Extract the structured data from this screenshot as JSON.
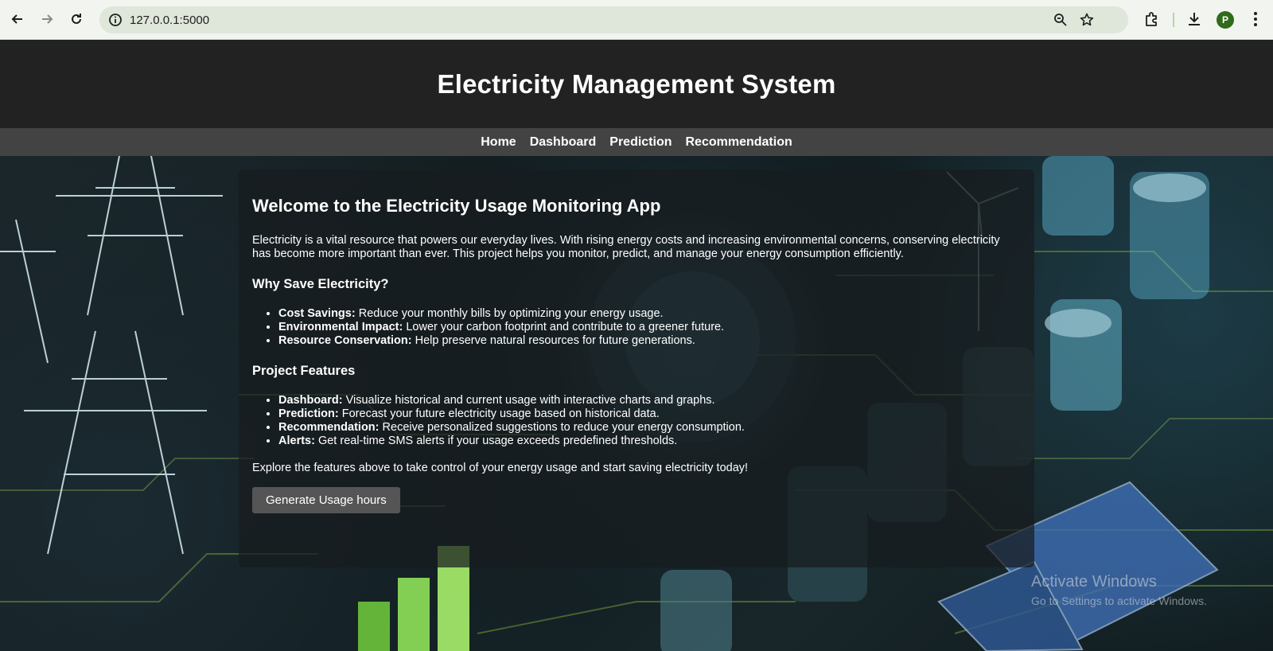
{
  "browser": {
    "url": "127.0.0.1:5000",
    "avatar_letter": "P",
    "icons": [
      "back-arrow-icon",
      "forward-arrow-icon",
      "reload-icon",
      "site-info-icon",
      "zoom-icon",
      "bookmark-star-icon",
      "extensions-icon",
      "download-icon",
      "kebab-menu-icon"
    ]
  },
  "header": {
    "title": "Electricity Management System"
  },
  "nav": {
    "items": [
      {
        "label": "Home"
      },
      {
        "label": "Dashboard"
      },
      {
        "label": "Prediction"
      },
      {
        "label": "Recommendation"
      }
    ]
  },
  "main": {
    "heading": "Welcome to the Electricity Usage Monitoring App",
    "intro": "Electricity is a vital resource that powers our everyday lives. With rising energy costs and increasing environmental concerns, conserving electricity has become more important than ever. This project helps you monitor, predict, and manage your energy consumption efficiently.",
    "why_heading": "Why Save Electricity?",
    "why_items": [
      {
        "term": "Cost Savings:",
        "text": " Reduce your monthly bills by optimizing your energy usage."
      },
      {
        "term": "Environmental Impact:",
        "text": " Lower your carbon footprint and contribute to a greener future."
      },
      {
        "term": "Resource Conservation:",
        "text": " Help preserve natural resources for future generations."
      }
    ],
    "features_heading": "Project Features",
    "features_items": [
      {
        "term": "Dashboard:",
        "text": " Visualize historical and current usage with interactive charts and graphs."
      },
      {
        "term": "Prediction:",
        "text": " Forecast your future electricity usage based on historical data."
      },
      {
        "term": "Recommendation:",
        "text": " Receive personalized suggestions to reduce your energy consumption."
      },
      {
        "term": "Alerts:",
        "text": " Get real-time SMS alerts if your usage exceeds predefined thresholds."
      }
    ],
    "explore": "Explore the features above to take control of your energy usage and start saving electricity today!",
    "button_label": "Generate Usage hours"
  },
  "watermark": {
    "line1": "Activate Windows",
    "line2": "Go to Settings to activate Windows."
  },
  "colors": {
    "header_bg": "#222222",
    "nav_bg": "#434343",
    "button_bg": "#555555",
    "accent_green": "#7ed321"
  }
}
